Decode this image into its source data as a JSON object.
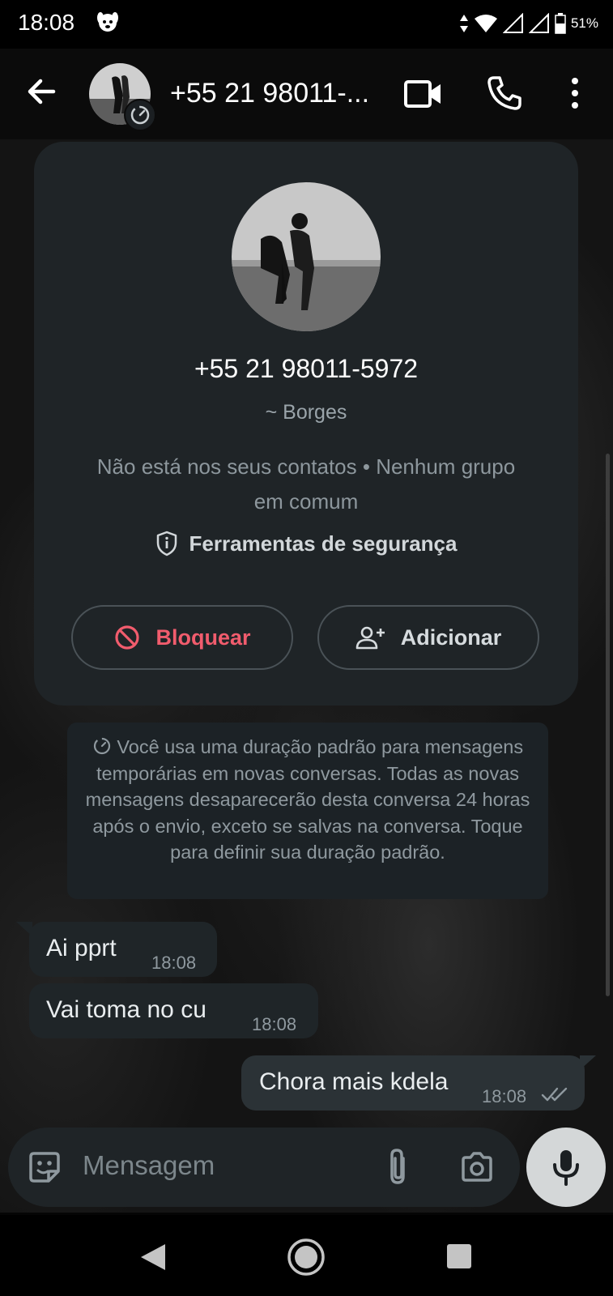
{
  "status_bar": {
    "time": "18:08",
    "battery": "51%",
    "icons": [
      "puppy-notification-icon",
      "data-arrows-icon",
      "wifi-icon",
      "signal-icon",
      "signal-icon",
      "battery-icon"
    ]
  },
  "header": {
    "title": "+55 21 98011-...",
    "icons": [
      "back-arrow-icon",
      "video-call-icon",
      "phone-call-icon",
      "more-vert-icon"
    ]
  },
  "profile_card": {
    "phone": "+55 21 98011-5972",
    "name": "~ Borges",
    "info": "Não está nos seus contatos • Nenhum grupo em comum",
    "safety_tools": "Ferramentas de segurança",
    "block_label": "Bloquear",
    "add_label": "Adicionar"
  },
  "system_message": {
    "text": "Você usa uma duração padrão para mensagens temporárias em novas conversas. Todas as novas mensagens desaparecerão desta conversa 24 horas após o envio, exceto se salvas na conversa. Toque para definir sua duração padrão."
  },
  "messages": [
    {
      "direction": "incoming",
      "text": "Ai pprt",
      "time": "18:08"
    },
    {
      "direction": "incoming",
      "text": "Vai toma no cu",
      "time": "18:08"
    },
    {
      "direction": "outgoing",
      "text": "Chora mais kdela",
      "time": "18:08",
      "status": "read"
    }
  ],
  "composer": {
    "placeholder": "Mensagem"
  },
  "colors": {
    "accent_block": "#f15c6d",
    "card_bg": "#1f2427",
    "outgoing_bubble": "#2b3236",
    "incoming_bubble": "#1f2528"
  }
}
